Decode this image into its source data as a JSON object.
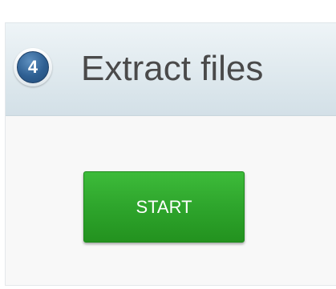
{
  "step": {
    "number": "4",
    "title": "Extract files"
  },
  "actions": {
    "start_label": "START"
  },
  "colors": {
    "badge": "#2e5f92",
    "start_button": "#2ea52c",
    "header_bg": "#dfe9ee"
  }
}
